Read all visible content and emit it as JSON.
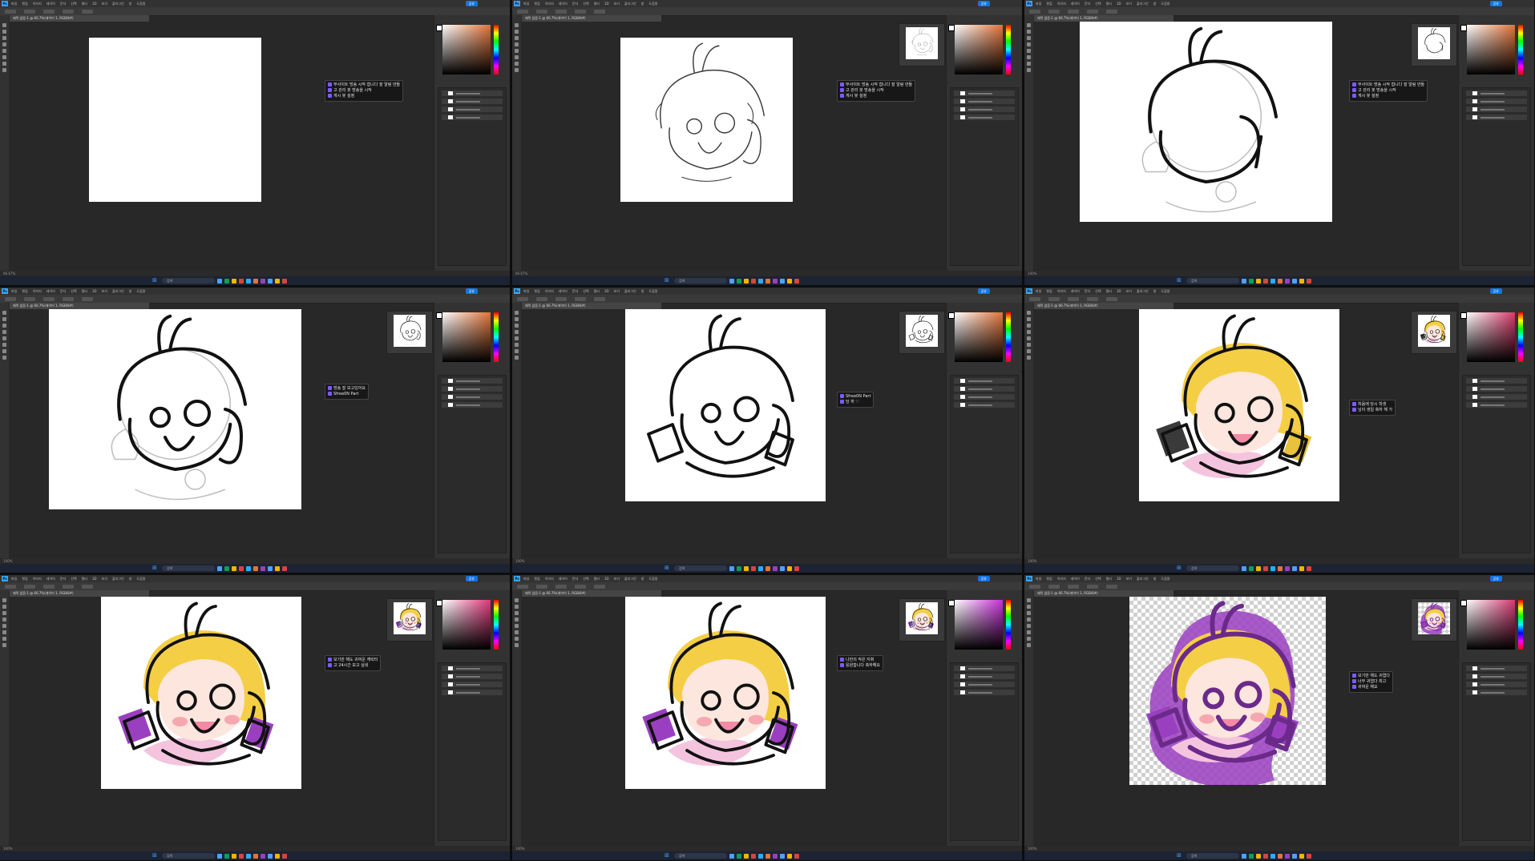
{
  "app": {
    "menu": [
      "파일",
      "편집",
      "이미지",
      "레이어",
      "문자",
      "선택",
      "필터",
      "3D",
      "보기",
      "플러그인",
      "창",
      "도움말"
    ],
    "share_label": "공유",
    "search_label": "검색",
    "tab_label": "제목 없음-1 @ 66.7%(레이어 1, RGB/8#)"
  },
  "frames": [
    {
      "stage": "blank",
      "status": "66.67%",
      "chat": [
        {
          "nick": "",
          "text": "무사이트 방송 시작 합니다 잘 알림 만들"
        },
        {
          "nick": "",
          "text": "고 관리 봇 방송을 시작"
        },
        {
          "nick": "",
          "text": "게시 봇 설정"
        }
      ]
    },
    {
      "stage": "sketch",
      "status": "66.67%",
      "chat": [
        {
          "nick": "",
          "text": "무사이트 방송 시작 합니다 잘 알림 만들"
        },
        {
          "nick": "",
          "text": "고 관리 봇 방송을 시작"
        },
        {
          "nick": "",
          "text": "게시 봇 설정"
        }
      ]
    },
    {
      "stage": "lineart-start",
      "status": "100%",
      "chat": [
        {
          "nick": "",
          "text": "무사이트 방송 시작 합니다 잘 알림 만들"
        },
        {
          "nick": "",
          "text": "고 관리 봇 방송을 시작"
        },
        {
          "nick": "",
          "text": "게시 봇 설정"
        }
      ]
    },
    {
      "stage": "lineart-mid",
      "status": "100%",
      "chat": [
        {
          "nick": "",
          "text": "방송 잘 보고있어요"
        },
        {
          "nick": "",
          "text": "Sfree0N Part"
        }
      ]
    },
    {
      "stage": "lineart-done",
      "status": "100%",
      "chat": [
        {
          "nick": "",
          "text": "Sfree0N Part"
        },
        {
          "nick": "",
          "text": "당 하 ♡"
        }
      ]
    },
    {
      "stage": "flat-color",
      "status": "100%",
      "chat": [
        {
          "nick": "",
          "text": "처음에 당시 학생"
        },
        {
          "nick": "",
          "text": "님이 생일 축하 해 가"
        }
      ]
    },
    {
      "stage": "color",
      "status": "100%",
      "chat": [
        {
          "nick": "",
          "text": "보기만 해도 귀여운 캐릭터"
        },
        {
          "nick": "",
          "text": "고 24시간 보고 싶네"
        }
      ]
    },
    {
      "stage": "shaded",
      "status": "100%",
      "chat": [
        {
          "nick": "",
          "text": "나만의 작은 지휘"
        },
        {
          "nick": "",
          "text": "응원합니다 축하해요"
        }
      ]
    },
    {
      "stage": "final",
      "status": "100%",
      "chat": [
        {
          "nick": "",
          "text": "보기만 해도 귀엽다"
        },
        {
          "nick": "",
          "text": "너무 귀엽다 최고"
        },
        {
          "nick": "",
          "text": "귀여운 해요"
        }
      ]
    }
  ],
  "colors": {
    "hair": "#f4cf46",
    "hair_shadow": "#e1a92e",
    "skin": "#fde6dd",
    "blush": "#f6a8b0",
    "outline": "#111111",
    "outline_final": "#6b2a8a",
    "accent_purple": "#9a3fbf",
    "dress": "#f4c4de",
    "mouth": "#f48aa6",
    "sketch_gray": "#bdbdbd",
    "panel_dark": "#323232",
    "workspace": "#282828",
    "accent_blue": "#1473e6"
  },
  "icons": [
    "brush-icon",
    "eraser-icon",
    "move-icon",
    "lasso-icon",
    "zoom-icon",
    "search-icon",
    "windows-start-icon"
  ]
}
